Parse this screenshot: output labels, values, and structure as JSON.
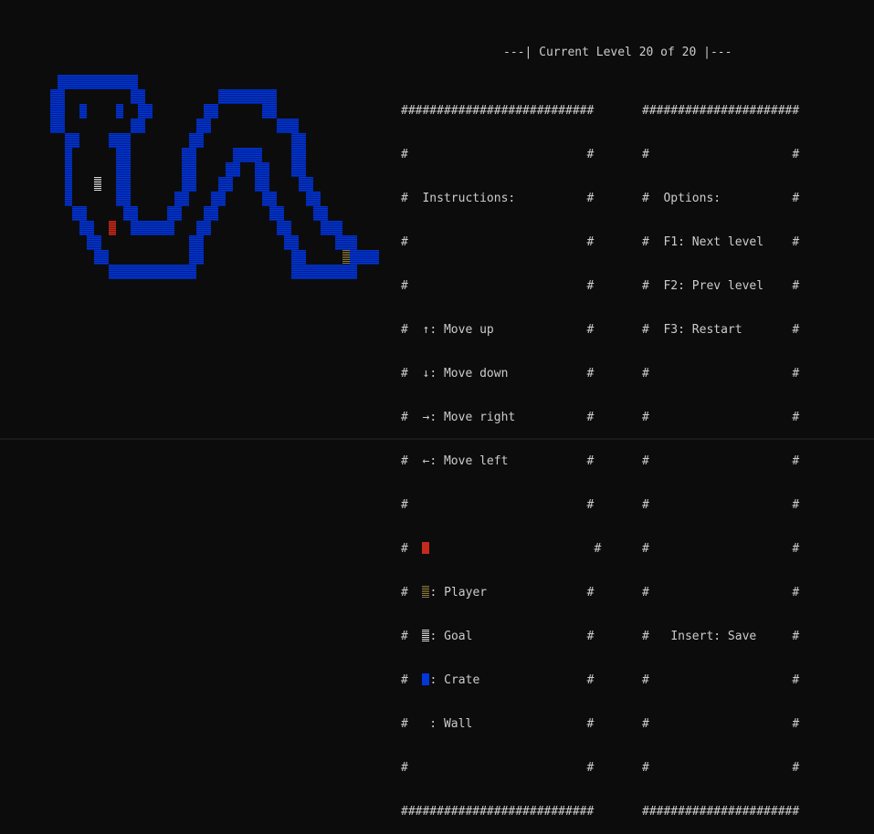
{
  "title": "---| Current Level 20 of 20 |---",
  "border_line_left": "###########################",
  "border_line_right": "######################",
  "instructions": {
    "heading": "Instructions:",
    "moves": [
      {
        "arrow": "↑",
        "label": ": Move up"
      },
      {
        "arrow": "↓",
        "label": ": Move down"
      },
      {
        "arrow": "→",
        "label": ": Move right"
      },
      {
        "arrow": "←",
        "label": ": Move left"
      }
    ],
    "legend": [
      {
        "label": ": Player",
        "color": "#c42b1c",
        "icon": "player-icon"
      },
      {
        "label": ": Goal",
        "color": "#d9d9d9",
        "icon": "goal-icon"
      },
      {
        "label": ": Crate",
        "color": "#0037da",
        "icon": "crate-icon"
      },
      {
        "label": " : Wall",
        "color": "#0037da",
        "icon": "wall-icon"
      }
    ]
  },
  "options": {
    "heading": "Options:",
    "items": [
      "F1: Next level",
      "F2: Prev level",
      "F3: Restart"
    ],
    "save": "Insert: Save"
  },
  "colors": {
    "background": "#0c0c0c",
    "wall": "#0037da",
    "player": "#c42b1c",
    "goal": "#d9d9d9",
    "crate_on_floor": "#8a7a3a",
    "text": "#cccccc"
  },
  "level": {
    "current": 20,
    "total": 20
  }
}
